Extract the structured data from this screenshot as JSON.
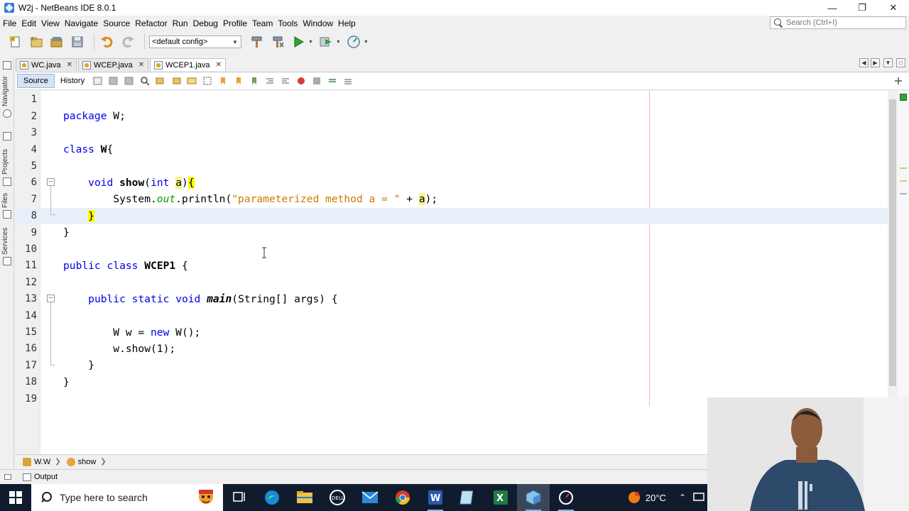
{
  "window": {
    "title": "W2j - NetBeans IDE 8.0.1",
    "controls": [
      "minimize",
      "maximize",
      "close"
    ]
  },
  "menu": {
    "items": [
      "File",
      "Edit",
      "View",
      "Navigate",
      "Source",
      "Refactor",
      "Run",
      "Debug",
      "Profile",
      "Team",
      "Tools",
      "Window",
      "Help"
    ]
  },
  "search": {
    "placeholder": "Search (Ctrl+I)"
  },
  "toolbar": {
    "config_value": "<default config>"
  },
  "side_tabs": [
    "Navigator",
    "Projects",
    "Files",
    "Services"
  ],
  "editor_tabs": [
    {
      "label": "WC.java",
      "active": false
    },
    {
      "label": "WCEP.java",
      "active": false
    },
    {
      "label": "WCEP1.java",
      "active": true
    }
  ],
  "source_bar": {
    "source_label": "Source",
    "history_label": "History"
  },
  "code": {
    "line_numbers": [
      "1",
      "2",
      "3",
      "4",
      "5",
      "6",
      "7",
      "8",
      "9",
      "10",
      "11",
      "12",
      "13",
      "14",
      "15",
      "16",
      "17",
      "18",
      "19"
    ],
    "lines": [
      "",
      "package W;",
      "",
      "class W{",
      "",
      "    void show(int a){",
      "        System.out.println(\"parameterized method a = \" + a);",
      "    }",
      "}",
      "",
      "public class WCEP1 {",
      "",
      "    public static void main(String[] args) {",
      "",
      "        W w = new W();",
      "        w.show(1);",
      "    }",
      "}",
      ""
    ],
    "current_line": 8
  },
  "breadcrumbs": [
    {
      "label": "W.W"
    },
    {
      "label": "show"
    }
  ],
  "output": {
    "label": "Output"
  },
  "taskbar": {
    "search_placeholder": "Type here to search",
    "temperature": "20°C",
    "apps": [
      "logo-mascot",
      "task-view",
      "edge",
      "file-explorer",
      "dell",
      "mail",
      "chrome",
      "word",
      "notepad",
      "excel",
      "netbeans",
      "clock-app"
    ]
  },
  "colors": {
    "keyword": "#0000e6",
    "string": "#ce7b00",
    "field_italic": "#009900",
    "highlight": "#ffff00",
    "taskbar": "#101c2e"
  }
}
